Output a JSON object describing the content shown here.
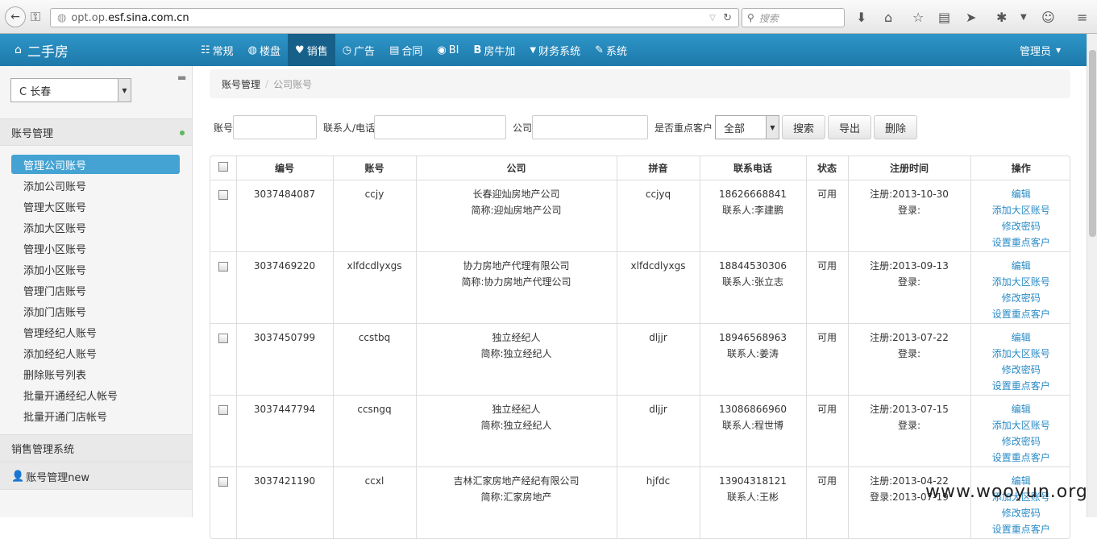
{
  "browser": {
    "url_prefix": "opt.op.",
    "url_host": "esf.sina.com.cn",
    "search_placeholder": "搜索"
  },
  "app": {
    "brand": "二手房",
    "admin": "管理员",
    "menu": [
      {
        "icon": "☷",
        "label": "常规"
      },
      {
        "icon": "◍",
        "label": "楼盘"
      },
      {
        "icon": "♥",
        "label": "销售"
      },
      {
        "icon": "◷",
        "label": "广告"
      },
      {
        "icon": "▤",
        "label": "合同"
      },
      {
        "icon": "◉",
        "label": "BI"
      },
      {
        "icon": "B",
        "label": "房牛加"
      },
      {
        "icon": "▼",
        "label": "财务系统"
      },
      {
        "icon": "✎",
        "label": "系统"
      }
    ]
  },
  "sidebar": {
    "city": "C 长春",
    "section1": "账号管理",
    "items": [
      "管理公司账号",
      "添加公司账号",
      "管理大区账号",
      "添加大区账号",
      "管理小区账号",
      "添加小区账号",
      "管理门店账号",
      "添加门店账号",
      "管理经纪人账号",
      "添加经纪人账号",
      "删除账号列表",
      "批量开通经纪人帐号",
      "批量开通门店帐号"
    ],
    "section2": "销售管理系统",
    "section3": "账号管理new"
  },
  "breadcrumb": {
    "parent": "账号管理",
    "sep": "/",
    "current": "公司账号"
  },
  "filters": {
    "account_label": "账号",
    "contact_label": "联系人/电话",
    "company_label": "公司",
    "key_label": "是否重点客户",
    "key_value": "全部",
    "search_btn": "搜索",
    "export_btn": "导出",
    "delete_btn": "删除"
  },
  "table": {
    "headers": [
      "编号",
      "账号",
      "公司",
      "拼音",
      "联系电话",
      "状态",
      "注册时间",
      "操作"
    ],
    "rows": [
      {
        "id": "3037484087",
        "account": "ccjy",
        "company": "长春迎灿房地产公司",
        "short": "简称:迎灿房地产公司",
        "pinyin": "ccjyq",
        "phone": "18626668841",
        "contact": "联系人:李建鹏",
        "status": "可用",
        "reg": "注册:2013-10-30",
        "login": "登录:"
      },
      {
        "id": "3037469220",
        "account": "xlfdcdlyxgs",
        "company": "协力房地产代理有限公司",
        "short": "简称:协力房地产代理公司",
        "pinyin": "xlfdcdlyxgs",
        "phone": "18844530306",
        "contact": "联系人:张立志",
        "status": "可用",
        "reg": "注册:2013-09-13",
        "login": "登录:"
      },
      {
        "id": "3037450799",
        "account": "ccstbq",
        "company": "独立经纪人",
        "short": "简称:独立经纪人",
        "pinyin": "dljjr",
        "phone": "18946568963",
        "contact": "联系人:姜涛",
        "status": "可用",
        "reg": "注册:2013-07-22",
        "login": "登录:"
      },
      {
        "id": "3037447794",
        "account": "ccsngq",
        "company": "独立经纪人",
        "short": "简称:独立经纪人",
        "pinyin": "dljjr",
        "phone": "13086866960",
        "contact": "联系人:程世博",
        "status": "可用",
        "reg": "注册:2013-07-15",
        "login": "登录:"
      },
      {
        "id": "3037421190",
        "account": "ccxl",
        "company": "吉林汇家房地产经纪有限公司",
        "short": "简称:汇家房地产",
        "pinyin": "hjfdc",
        "phone": "13904318121",
        "contact": "联系人:王彬",
        "status": "可用",
        "reg": "注册:2013-04-22",
        "login": "登录:2013-07-19"
      }
    ],
    "ops": [
      "编辑",
      "添加大区账号",
      "修改密码",
      "设置重点客户"
    ]
  },
  "watermark": "www.wooyun.org",
  "colors": {
    "navbar": "#1d79aa",
    "active_menu": "#16608a",
    "sidebar_active": "#45a3d3",
    "link": "#2a8bc6"
  }
}
